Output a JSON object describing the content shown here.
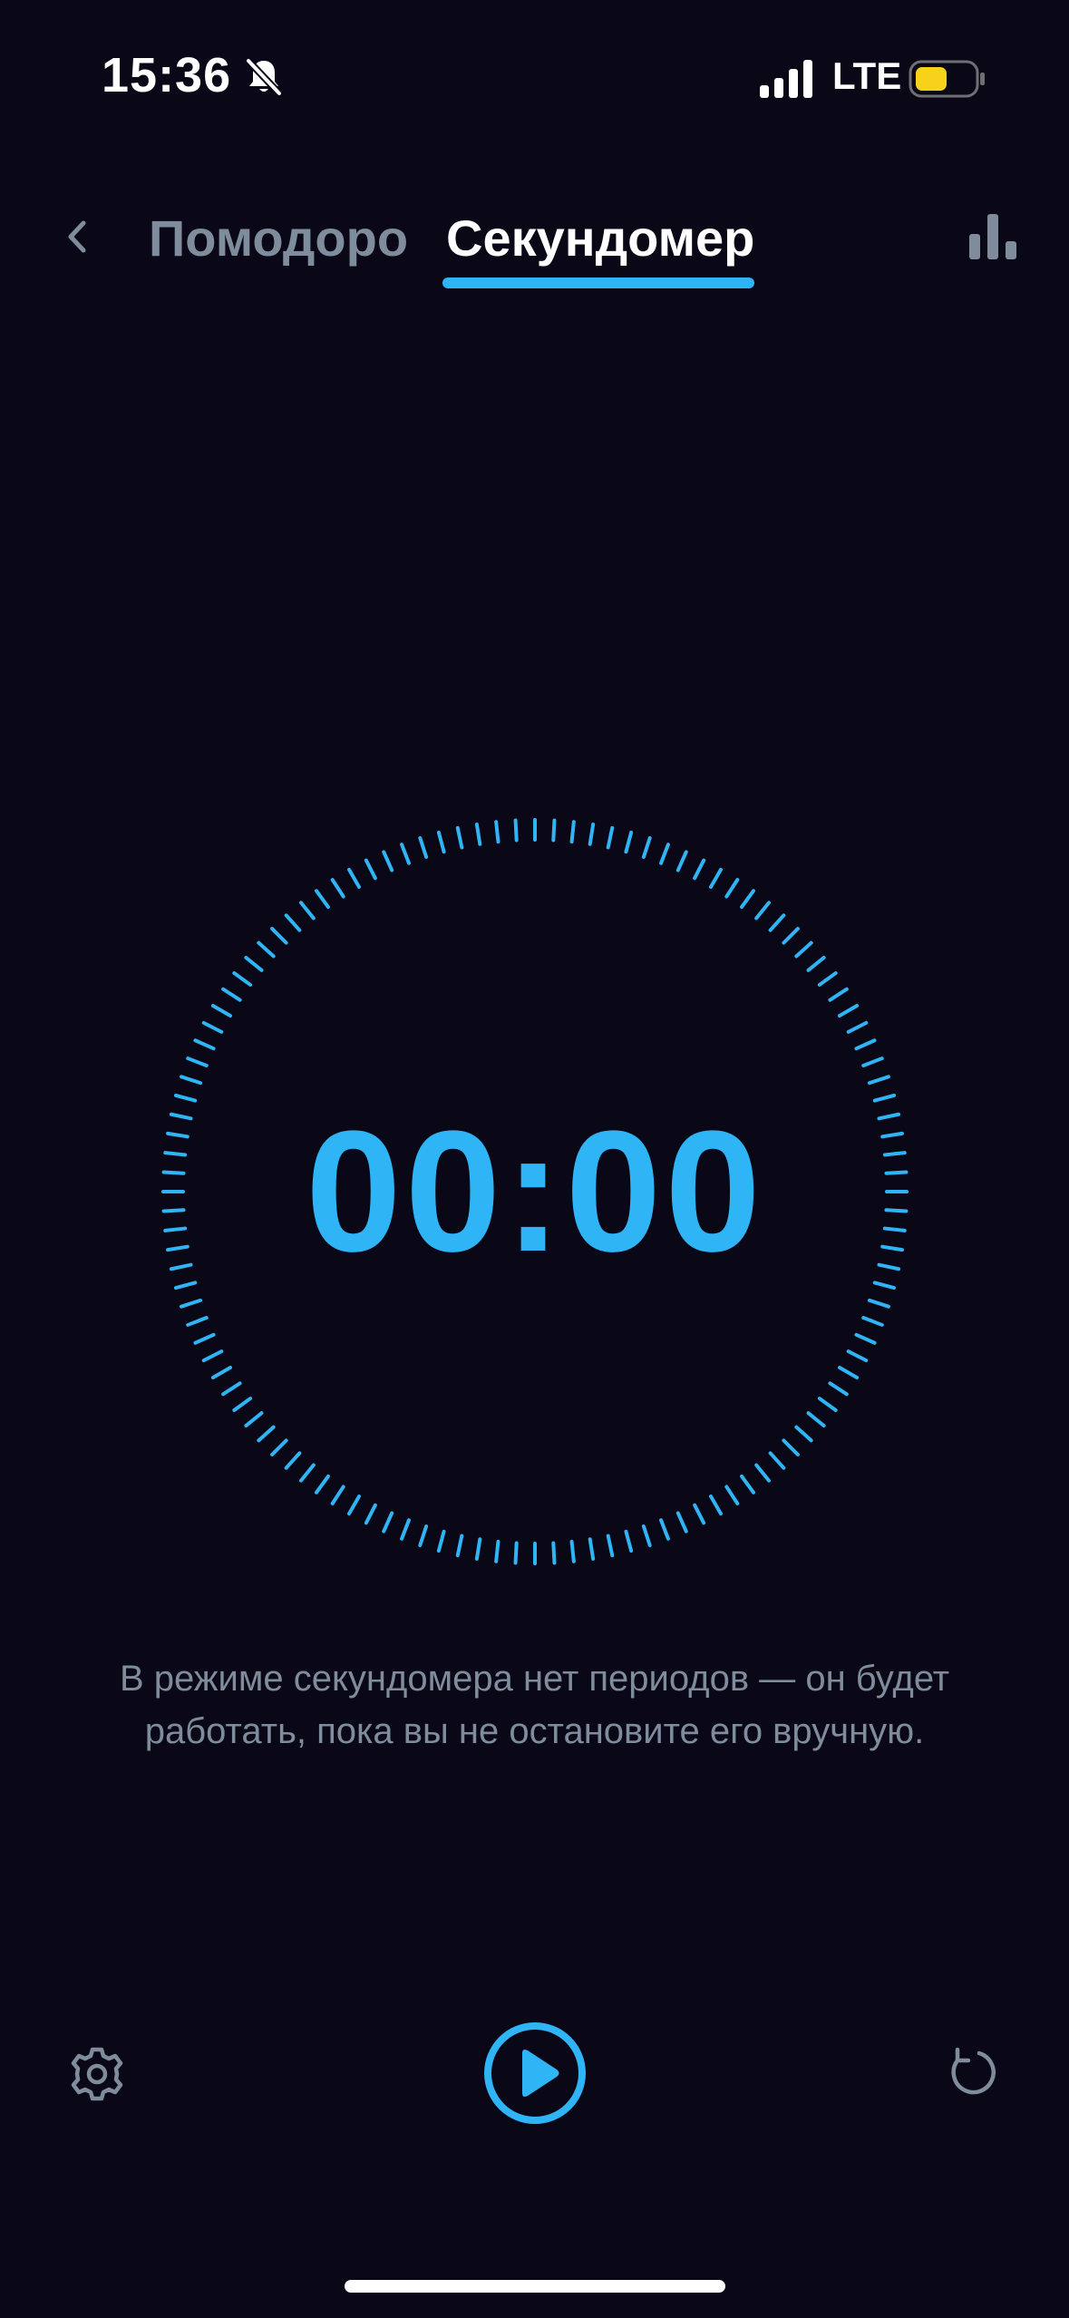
{
  "status_bar": {
    "time": "15:36",
    "network": "LTE",
    "icons": [
      "bell-slash-icon",
      "cellular-signal-icon",
      "battery-icon"
    ],
    "battery_color": "#f7d11a"
  },
  "header": {
    "back_icon": "chevron-left-icon",
    "tabs": [
      {
        "label": "Помодоро",
        "active": false
      },
      {
        "label": "Секундомер",
        "active": true
      }
    ],
    "stats_icon": "bar-chart-icon"
  },
  "timer": {
    "value": "00:00"
  },
  "hint": {
    "text": "В режиме секундомера нет периодов — он будет работать, пока вы не остановите его вручную."
  },
  "controls": {
    "settings_icon": "gear-icon",
    "play_icon": "play-icon",
    "reset_icon": "reset-icon"
  },
  "colors": {
    "background": "#0a0717",
    "accent": "#2fb5f5",
    "muted": "#7e8c9c",
    "text": "#ffffff"
  }
}
